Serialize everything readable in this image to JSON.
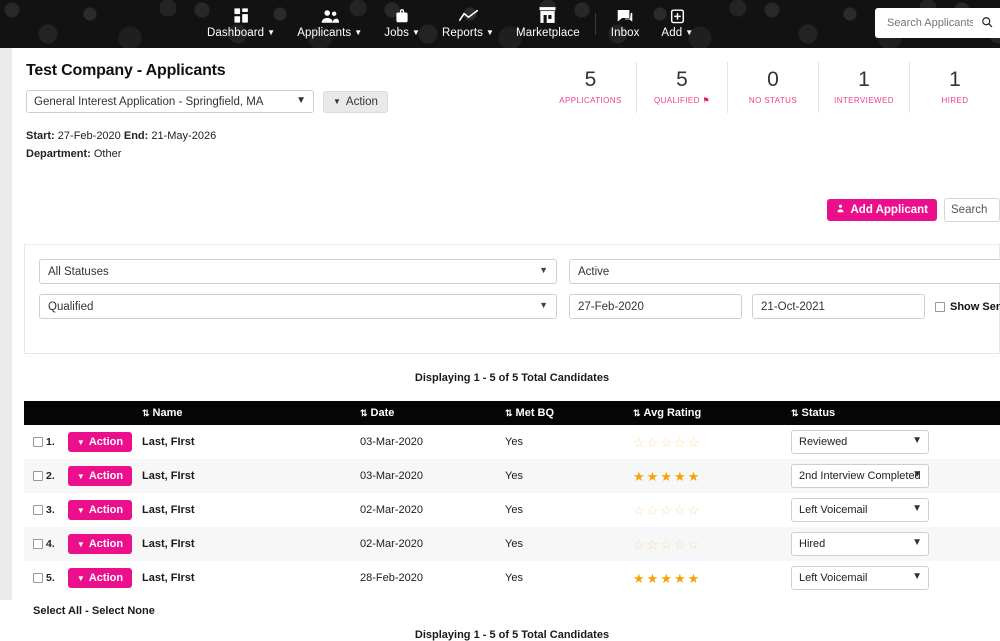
{
  "topnav": {
    "items": [
      {
        "label": "Dashboard",
        "icon": "grid-icon",
        "caret": true
      },
      {
        "label": "Applicants",
        "icon": "people-icon",
        "caret": true
      },
      {
        "label": "Jobs",
        "icon": "briefcase-icon",
        "caret": true
      },
      {
        "label": "Reports",
        "icon": "line-chart-icon",
        "caret": true
      },
      {
        "label": "Marketplace",
        "icon": "storefront-icon",
        "caret": false
      },
      {
        "label": "Inbox",
        "icon": "chat-bubble-icon",
        "caret": false
      },
      {
        "label": "Add",
        "icon": "plus-box-icon",
        "caret": true
      }
    ],
    "search": {
      "placeholder": "Search Applicants",
      "value": "",
      "icon": "search-icon"
    }
  },
  "header": {
    "title": "Test Company - Applicants",
    "job_select_value": "General Interest Application - Springfield, MA",
    "action_label": "Action",
    "start_label": "Start:",
    "start_value": "27-Feb-2020",
    "end_label": "End:",
    "end_value": "21-May-2026",
    "department_label": "Department:",
    "department_value": "Other",
    "add_applicant_label": "Add Applicant",
    "search_applicants_value": "Search"
  },
  "stats": [
    {
      "value": "5",
      "label": "APPLICATIONS",
      "flag": false
    },
    {
      "value": "5",
      "label": "QUALIFIED",
      "flag": true
    },
    {
      "value": "0",
      "label": "NO STATUS",
      "flag": false
    },
    {
      "value": "1",
      "label": "INTERVIEWED",
      "flag": false
    },
    {
      "value": "1",
      "label": "HIRED",
      "flag": false
    }
  ],
  "filters": {
    "status_select": "All Statuses",
    "qualified_select": "Qualified",
    "active_field": "Active",
    "date_from": "27-Feb-2020",
    "date_to": "21-Oct-2021",
    "show_sent_emails_label": "Show Sent Emails",
    "show_sent_emails_checked": false
  },
  "table": {
    "displaying_top": "Displaying 1 - 5 of 5 Total Candidates",
    "displaying_bottom": "Displaying 1 - 5 of 5 Total Candidates",
    "select_all_label": "Select All - Select None",
    "columns": [
      {
        "label": "Name",
        "sortable": true
      },
      {
        "label": "Date",
        "sortable": true
      },
      {
        "label": "Met BQ",
        "sortable": true
      },
      {
        "label": "Avg Rating",
        "sortable": true
      },
      {
        "label": "Status",
        "sortable": true
      }
    ],
    "action_label": "Action",
    "rows": [
      {
        "index": "1.",
        "name": "Last, FIrst",
        "date": "03-Mar-2020",
        "met_bq": "Yes",
        "rating": 0,
        "status": "Reviewed",
        "checked": false
      },
      {
        "index": "2.",
        "name": "Last, FIrst",
        "date": "03-Mar-2020",
        "met_bq": "Yes",
        "rating": 5,
        "status": "2nd Interview Completed",
        "checked": false
      },
      {
        "index": "3.",
        "name": "Last, FIrst",
        "date": "02-Mar-2020",
        "met_bq": "Yes",
        "rating": 0,
        "status": "Left Voicemail",
        "checked": false
      },
      {
        "index": "4.",
        "name": "Last, FIrst",
        "date": "02-Mar-2020",
        "met_bq": "Yes",
        "rating": 0,
        "status": "Hired",
        "checked": false
      },
      {
        "index": "5.",
        "name": "Last, FIrst",
        "date": "28-Feb-2020",
        "met_bq": "Yes",
        "rating": 5,
        "status": "Left Voicemail",
        "checked": false
      }
    ]
  },
  "colors": {
    "brand_pink": "#ec0f8c",
    "accent_pink": "#ef3e8c",
    "nav_dark": "#121212",
    "star_on": "#f5a300",
    "star_off": "#fbd9a6"
  }
}
